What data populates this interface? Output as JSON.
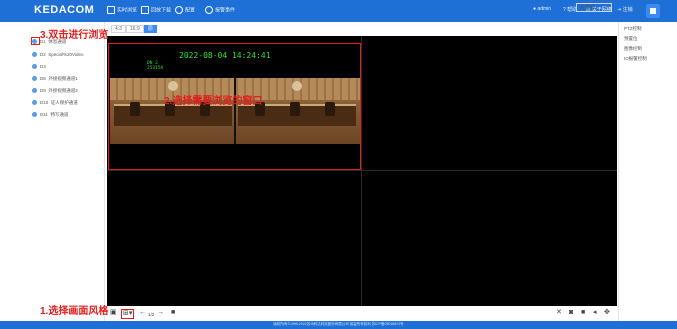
{
  "app": {
    "logo": "KEDACOM"
  },
  "nav": [
    {
      "label": "实时浏览",
      "icon": "monitor-icon"
    },
    {
      "label": "回放下载",
      "icon": "playback-icon"
    },
    {
      "label": "配置",
      "icon": "tools-icon"
    },
    {
      "label": "报警事件",
      "icon": "alarm-icon"
    }
  ],
  "right_menu": {
    "user": "admin",
    "help": "帮助",
    "about": "关于网络",
    "logout": "注销"
  },
  "sidebar": {
    "header": "设备列表",
    "devices": [
      {
        "id": "D1",
        "name": "休息通道"
      },
      {
        "id": "D2",
        "name": "Special%20Video"
      },
      {
        "id": "D3",
        "name": ""
      },
      {
        "id": "D8",
        "name": "外接视频通道1"
      },
      {
        "id": "D9",
        "name": "外接视频通道2"
      },
      {
        "id": "D10",
        "name": "证人保护通道"
      },
      {
        "id": "D11",
        "name": "特写通道"
      }
    ]
  },
  "toolbar": {
    "tabs": [
      "4:3",
      "16:9",
      "原"
    ],
    "active_tab_index": 2,
    "select_value": "可变时"
  },
  "video": {
    "osd_time": "2022-08-04  14:24:41",
    "osd_channel": [
      "DN 2",
      "25315A"
    ]
  },
  "right_panel": {
    "items": [
      "PTZ控制",
      "预置位",
      "图像控制",
      "IO报警控制"
    ]
  },
  "bottom_toolbar": {
    "left_icons": [
      "close-all-icon",
      "layout-icon",
      "prev-icon",
      "page-indicator",
      "next-icon",
      "stop-icon"
    ],
    "page_indicator": "1/2",
    "right_icons": [
      "close-icon",
      "capture-icon",
      "record-icon",
      "audio-icon",
      "ptz-icon"
    ]
  },
  "footer": {
    "text": "版权所有©1995-2022苏州科达科技股份有限公司 保留所有权利 苏ICP备05018823号"
  },
  "annotations": {
    "step1": "1.选择画面风格",
    "step2": "2.选择需要浏览的窗口",
    "step3": "3.双击进行浏览"
  },
  "colors": {
    "topbar": "#1e6fd6",
    "accent": "#3a8af0",
    "annotation": "#e01e1e",
    "osd": "#2ee02e"
  }
}
